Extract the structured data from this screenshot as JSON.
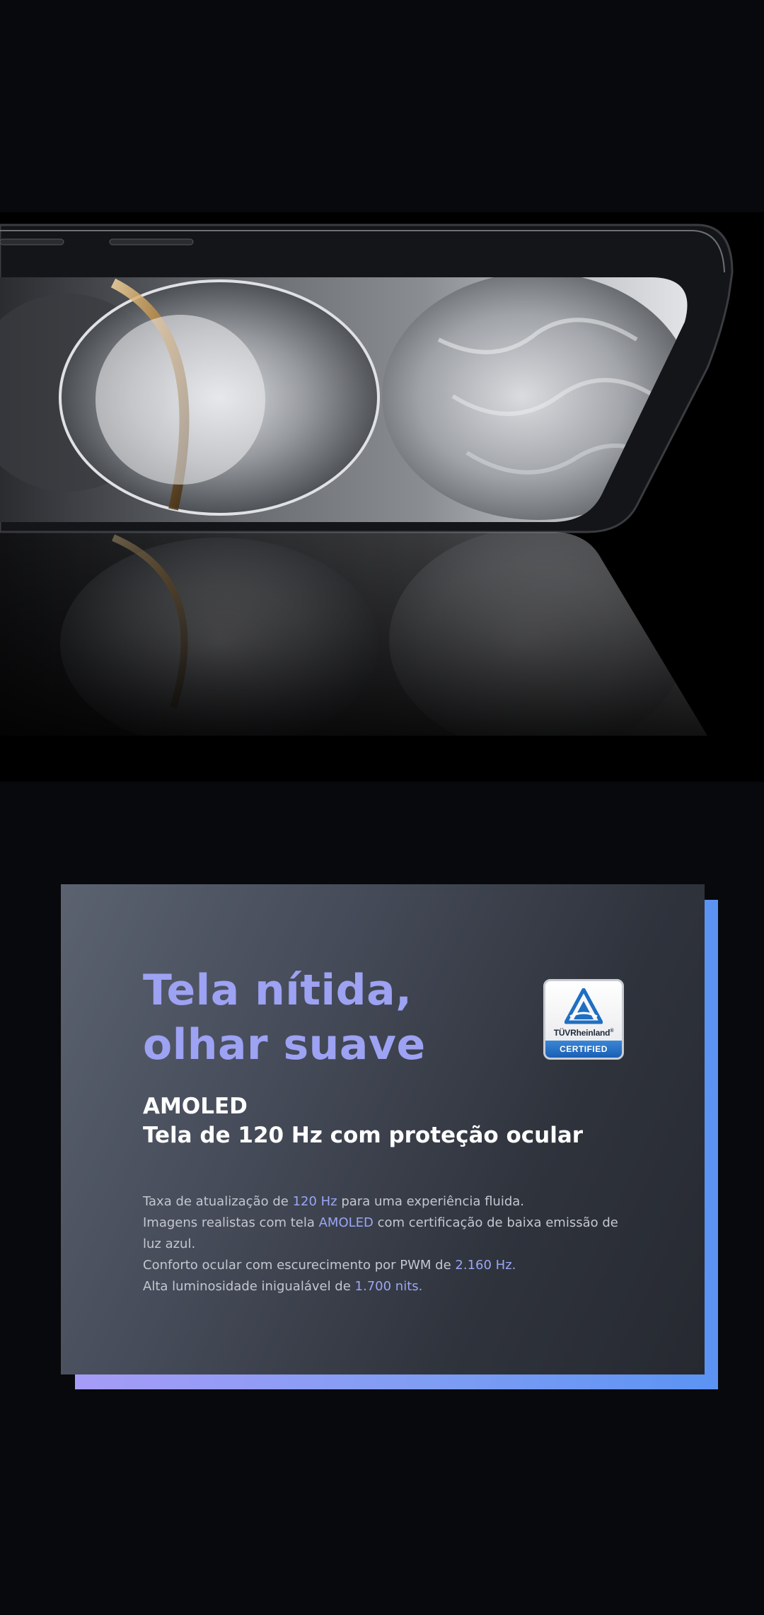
{
  "hero": {
    "image_name": "phone-display-hero"
  },
  "feature_card": {
    "headline_line1": "Tela nítida,",
    "headline_line2": "olhar suave",
    "badge": {
      "brand_prefix": "TÜV",
      "brand_name": "Rheinland",
      "registered": "®",
      "label": "CERTIFIED"
    },
    "subhead_line1": "AMOLED",
    "subhead_line2": "Tela de 120 Hz com proteção ocular",
    "body": {
      "line1_pre": "Taxa de atualização de ",
      "line1_hl": "120 Hz",
      "line1_post": " para uma experiência fluida.",
      "line2_pre": "Imagens realistas com tela ",
      "line2_hl": "AMOLED",
      "line2_post": " com certificação de baixa emissão de luz azul.",
      "line3_pre": "Conforto ocular com escurecimento por PWM de ",
      "line3_hl": "2.160 Hz.",
      "line4_pre": "Alta luminosidade inigualável de ",
      "line4_hl": "1.700 nits."
    }
  },
  "colors": {
    "page_background": "#08090c",
    "headline": "#9da2f3",
    "highlight": "#9aa6f5",
    "accent_blue": "#5b93f3",
    "accent_violet": "#a69cf7"
  }
}
